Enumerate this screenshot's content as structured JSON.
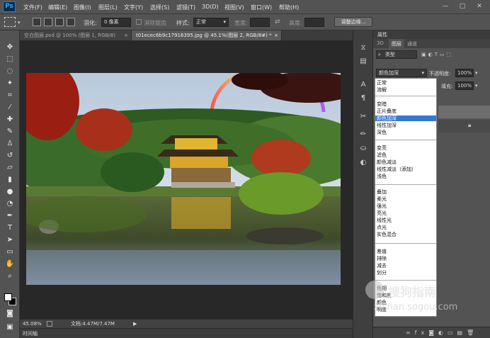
{
  "app": {
    "logo": "Ps"
  },
  "menu": [
    "文件(F)",
    "编辑(E)",
    "图像(I)",
    "图层(L)",
    "文字(Y)",
    "选择(S)",
    "滤镜(T)",
    "3D(D)",
    "视图(V)",
    "窗口(W)",
    "帮助(H)"
  ],
  "window_buttons": [
    "—",
    "□",
    "✕"
  ],
  "options": {
    "feather_label": "羽化:",
    "feather_value": "0 像素",
    "antialias_label": "消除锯齿",
    "style_label": "样式:",
    "style_value": "正常",
    "width_label": "宽度:",
    "height_label": "高度:",
    "refine_button": "调整边缘..."
  },
  "tabs": [
    {
      "label": "空白图层.psd @ 100% (图层 1, RGB/8)",
      "close": "×"
    },
    {
      "label": "t01ecec6b9c17916395.jpg @ 45.1%(图层 2, RGB/8#) *",
      "close": "×"
    }
  ],
  "status": {
    "zoom": "45.08%",
    "doc": "文档:4.47M/7.47M",
    "timeline": "时间轴"
  },
  "panel": {
    "title": "属性",
    "tabs": [
      "3D",
      "图层",
      "通道"
    ],
    "filter_label": "类型",
    "blend_value": "颜色加深",
    "opacity_label": "不透明度:",
    "opacity_value": "100%",
    "fill_label": "填充:",
    "fill_value": "100%"
  },
  "blend_modes": [
    [
      "正常",
      "溶解"
    ],
    [
      "变暗",
      "正片叠底",
      "颜色加深",
      "线性加深",
      "深色"
    ],
    [
      "变亮",
      "滤色",
      "颜色减淡",
      "线性减淡（添加）",
      "浅色"
    ],
    [
      "叠加",
      "柔光",
      "强光",
      "亮光",
      "线性光",
      "点光",
      "实色混合"
    ],
    [
      "差值",
      "排除",
      "减去",
      "划分"
    ],
    [
      "色相",
      "饱和度",
      "颜色",
      "明度"
    ]
  ],
  "selected_blend": "颜色加深",
  "watermark": {
    "brand": "搜狗指南",
    "url": "zhinan.sogou.com"
  },
  "colors": {
    "ui_dark": "#535353",
    "canvas": "#282828",
    "accent": "#3478d6",
    "ps_blue": "#31a8ff"
  }
}
